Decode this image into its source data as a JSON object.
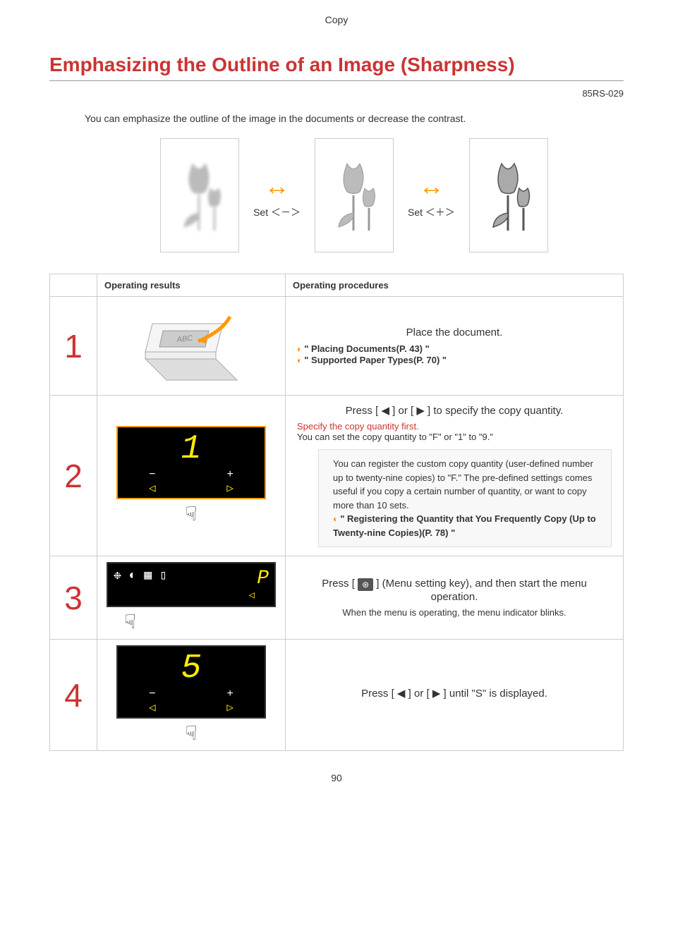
{
  "header": {
    "label": "Copy"
  },
  "title": "Emphasizing the Outline of an Image (Sharpness)",
  "ref_id": "85RS-029",
  "intro": "You can emphasize the outline of the image in the documents or decrease the contrast.",
  "sets": {
    "minus": "Set ＜－＞",
    "plus": "Set ＜＋＞"
  },
  "table": {
    "col1": "Operating results",
    "col2": "Operating procedures"
  },
  "steps": [
    {
      "num": "1",
      "proc_main": "Place the document.",
      "links": [
        "\" Placing Documents(P. 43) \"",
        "\" Supported Paper Types(P. 70) \""
      ]
    },
    {
      "num": "2",
      "screen_char": "1",
      "proc_main_prefix": "Press [ ",
      "proc_main_suffix": " ] to specify the copy quantity.",
      "proc_main_mid": " ] or [ ",
      "red_note": "Specify the copy quantity first.",
      "sub": "You can set the copy quantity to \"F\" or \"1\" to \"9.\"",
      "note_body": "You can register the custom copy quantity (user-defined number up to twenty-nine copies) to \"F.\" The pre-defined settings comes useful if you copy a certain number of quantity, or want to copy more than 10 sets.",
      "note_link": "\" Registering the Quantity that You Frequently Copy (Up to Twenty-nine Copies)(P. 78) \""
    },
    {
      "num": "3",
      "screen_char": "P",
      "icons_row": "❉  ◐ ▦ ▯",
      "proc_main_prefix": "Press [ ",
      "proc_main_suffix": " ] (Menu setting key), and then start the menu operation.",
      "sub": "When the menu is operating, the menu indicator blinks."
    },
    {
      "num": "4",
      "screen_char": "5",
      "proc_main_prefix": "Press [ ",
      "proc_main_mid": " ] or [ ",
      "proc_main_suffix": " ] until \"S\" is displayed."
    }
  ],
  "page_number": "90"
}
